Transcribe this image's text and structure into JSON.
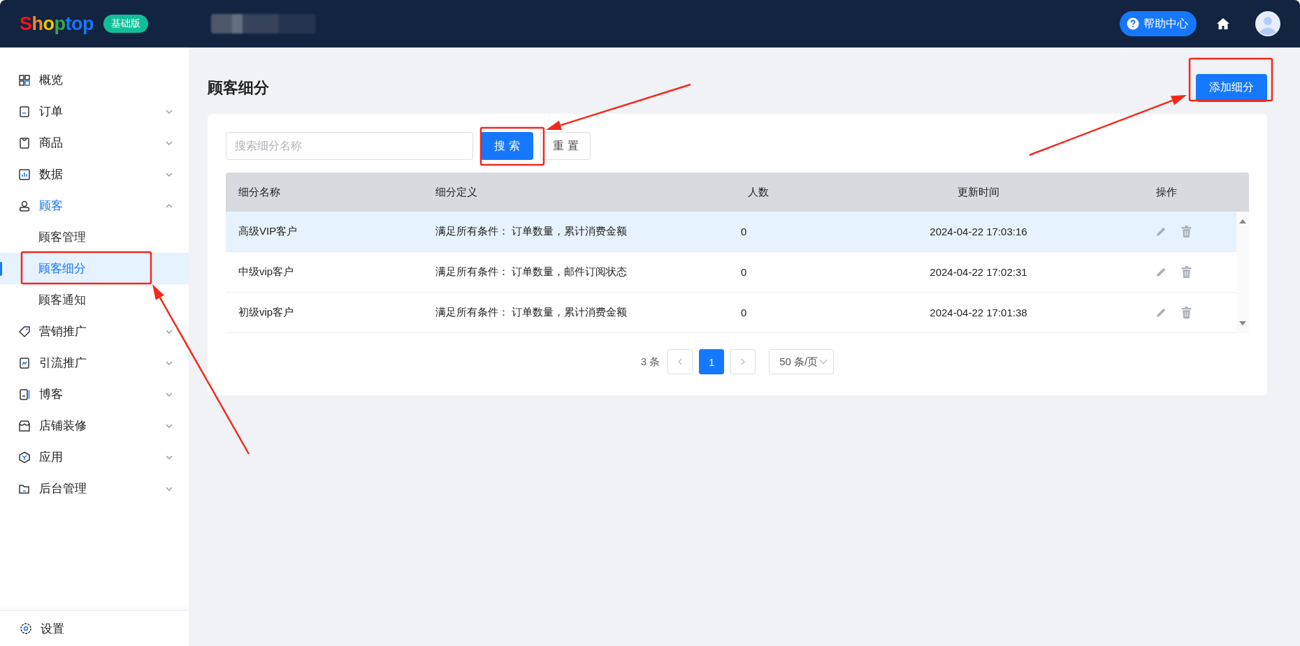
{
  "header": {
    "logo": "Shoptop",
    "plan_badge": "基础版",
    "help": "帮助中心"
  },
  "sidebar": {
    "items": [
      {
        "label": "概览",
        "kind": "link",
        "active": false
      },
      {
        "label": "订单",
        "kind": "group",
        "active": false,
        "expanded": false
      },
      {
        "label": "商品",
        "kind": "group",
        "active": false,
        "expanded": false
      },
      {
        "label": "数据",
        "kind": "group",
        "active": false,
        "expanded": false
      },
      {
        "label": "顾客",
        "kind": "group",
        "active": true,
        "expanded": true,
        "children": [
          {
            "label": "顾客管理",
            "selected": false
          },
          {
            "label": "顾客细分",
            "selected": true
          },
          {
            "label": "顾客通知",
            "selected": false
          }
        ]
      },
      {
        "label": "营销推广",
        "kind": "group",
        "active": false,
        "expanded": false
      },
      {
        "label": "引流推广",
        "kind": "group",
        "active": false,
        "expanded": false
      },
      {
        "label": "博客",
        "kind": "group",
        "active": false,
        "expanded": false
      },
      {
        "label": "店铺装修",
        "kind": "group",
        "active": false,
        "expanded": false
      },
      {
        "label": "应用",
        "kind": "group",
        "active": false,
        "expanded": false
      },
      {
        "label": "后台管理",
        "kind": "group",
        "active": false,
        "expanded": false
      }
    ],
    "settings": "设置"
  },
  "page": {
    "title": "顾客细分",
    "add_button": "添加细分"
  },
  "search": {
    "placeholder": "搜索细分名称",
    "search_button": "搜索",
    "reset_button": "重置"
  },
  "table": {
    "columns": [
      "细分名称",
      "细分定义",
      "人数",
      "更新时间",
      "操作"
    ],
    "rows": [
      {
        "name": "高级VIP客户",
        "definition": "满足所有条件： 订单数量，累计消费金额",
        "count": "0",
        "updated": "2024-04-22 17:03:16",
        "selected": true
      },
      {
        "name": "中级vip客户",
        "definition": "满足所有条件： 订单数量，邮件订阅状态",
        "count": "0",
        "updated": "2024-04-22 17:02:31",
        "selected": false
      },
      {
        "name": "初级vip客户",
        "definition": "满足所有条件： 订单数量，累计消费金额",
        "count": "0",
        "updated": "2024-04-22 17:01:38",
        "selected": false
      }
    ]
  },
  "pagination": {
    "total": "3 条",
    "pages": [
      {
        "label": "1",
        "selected": true
      }
    ],
    "page_size": "50 条/页"
  }
}
